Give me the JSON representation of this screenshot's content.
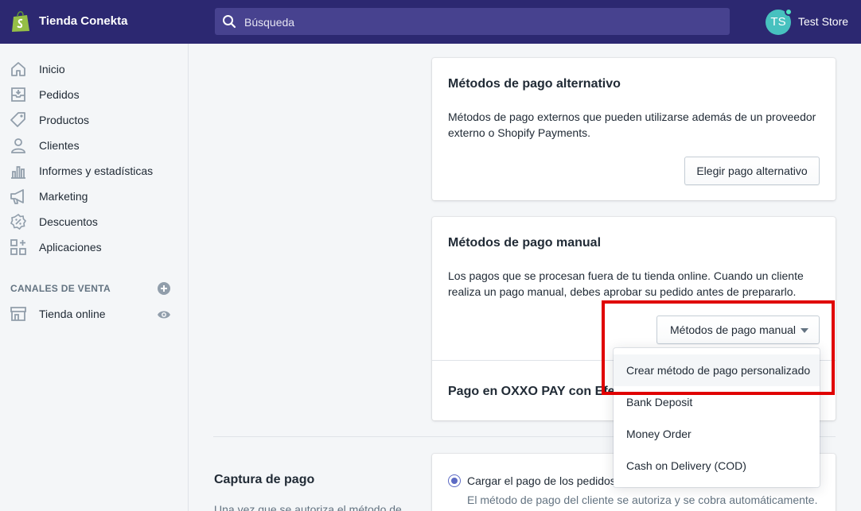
{
  "topbar": {
    "store_name": "Tienda Conekta",
    "search_placeholder": "Búsqueda",
    "user_initials": "TS",
    "user_name": "Test Store"
  },
  "sidebar": {
    "items": [
      {
        "label": "Inicio",
        "icon": "home-icon"
      },
      {
        "label": "Pedidos",
        "icon": "orders-icon"
      },
      {
        "label": "Productos",
        "icon": "tag-icon"
      },
      {
        "label": "Clientes",
        "icon": "customer-icon"
      },
      {
        "label": "Informes y estadísticas",
        "icon": "analytics-icon"
      },
      {
        "label": "Marketing",
        "icon": "megaphone-icon"
      },
      {
        "label": "Descuentos",
        "icon": "discount-icon"
      },
      {
        "label": "Aplicaciones",
        "icon": "apps-icon"
      }
    ],
    "sales_channels_label": "CANALES DE VENTA",
    "online_store_label": "Tienda online"
  },
  "alt_payments": {
    "title": "Métodos de pago alternativo",
    "desc_line1": "Métodos de pago externos que pueden utilizarse además de un proveedor",
    "desc_line2": "externo o Shopify Payments.",
    "button": "Elegir pago alternativo"
  },
  "manual_payments": {
    "title": "Métodos de pago manual",
    "desc_line1": "Los pagos que se procesan fuera de tu tienda online. Cuando un cliente",
    "desc_line2": "realiza un pago manual, debes aprobar su pedido antes de prepararlo.",
    "button": "Métodos de pago manual",
    "oxxo_label": "Pago en OXXO PAY con Efect"
  },
  "dropdown": {
    "items": [
      "Crear método de pago personalizado",
      "Bank Deposit",
      "Money Order",
      "Cash on Delivery (COD)"
    ]
  },
  "capture": {
    "title": "Captura de pago",
    "desc": "Una vez que se autoriza el método de",
    "option_label": "Cargar el pago de los pedidos",
    "option_desc": "El método de pago del cliente se autoriza y se cobra automáticamente."
  },
  "colors": {
    "topbar": "#2c2871",
    "accent": "#5c6ac4",
    "highlight": "#e00000"
  }
}
